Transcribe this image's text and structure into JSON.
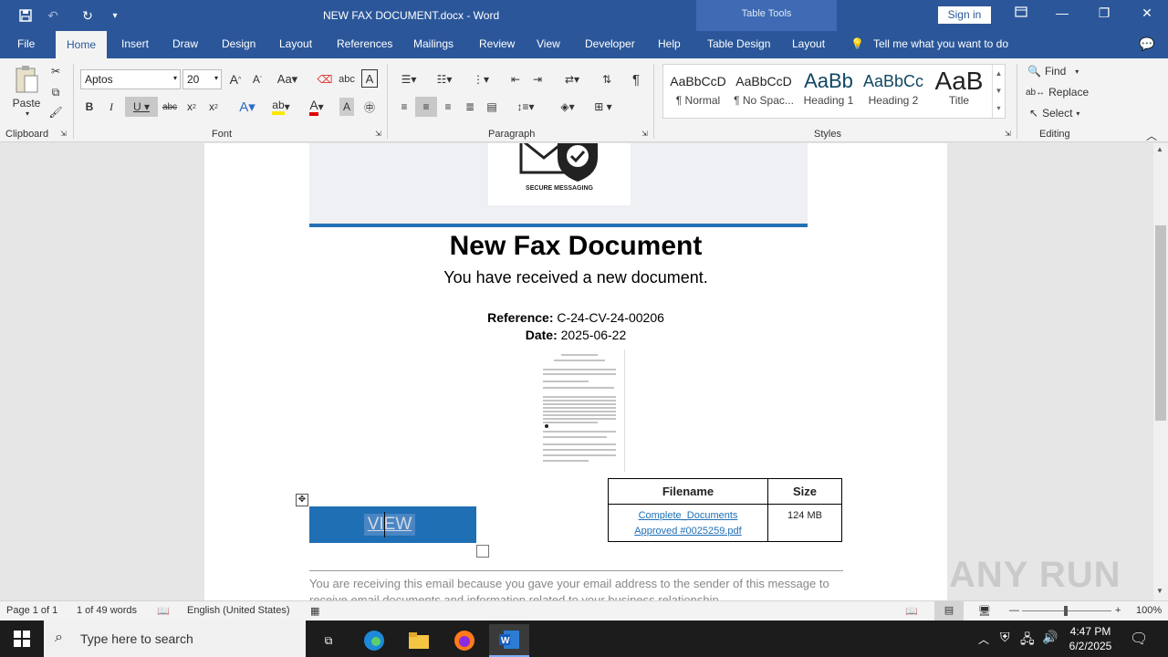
{
  "app": {
    "doc_title": "NEW FAX DOCUMENT.docx  -  Word",
    "table_tools": "Table Tools",
    "sign_in": "Sign in"
  },
  "tabs": [
    "File",
    "Home",
    "Insert",
    "Draw",
    "Design",
    "Layout",
    "References",
    "Mailings",
    "Review",
    "View",
    "Developer",
    "Help",
    "Table Design",
    "Layout"
  ],
  "tell_me": "Tell me what you want to do",
  "ribbon": {
    "clipboard": {
      "label": "Clipboard",
      "paste": "Paste"
    },
    "font": {
      "label": "Font",
      "font_name": "Aptos",
      "font_size": "20"
    },
    "paragraph": {
      "label": "Paragraph"
    },
    "styles": {
      "label": "Styles",
      "items": [
        {
          "preview": "AaBbCcD",
          "name": "¶ Normal"
        },
        {
          "preview": "AaBbCcD",
          "name": "¶ No Spac..."
        },
        {
          "preview": "AaBb",
          "name": "Heading 1"
        },
        {
          "preview": "AaBbCc",
          "name": "Heading 2"
        },
        {
          "preview": "AaB",
          "name": "Title"
        }
      ]
    },
    "editing": {
      "label": "Editing",
      "find": "Find",
      "replace": "Replace",
      "select": "Select"
    }
  },
  "document": {
    "banner_caption": "SECURE MESSAGING",
    "heading": "New Fax Document",
    "subheading": "You have received a new document.",
    "reference_label": "Reference:",
    "reference_value": "C-24-CV-24-00206",
    "date_label": "Date:",
    "date_value": "2025-06-22",
    "table": {
      "headers": [
        "Filename",
        "Size"
      ],
      "rows": [
        {
          "filename": "Complete_Documents Approved #0025259.pdf",
          "size": "124 MB"
        }
      ]
    },
    "view_button": "VIEW",
    "footer": "You are receiving this email because you gave your email address to the sender of this message to receive email documents and information related to your business relationship."
  },
  "status": {
    "page": "Page 1 of 1",
    "words": "1 of 49 words",
    "language": "English (United States)",
    "zoom": "100%"
  },
  "taskbar": {
    "search_placeholder": "Type here to search",
    "time": "4:47 PM",
    "date": "6/2/2025"
  },
  "watermark": "ANY RUN",
  "colors": {
    "accent": "#2b579a",
    "banner_line": "#2370b4",
    "view_button": "#1f6fb5"
  }
}
